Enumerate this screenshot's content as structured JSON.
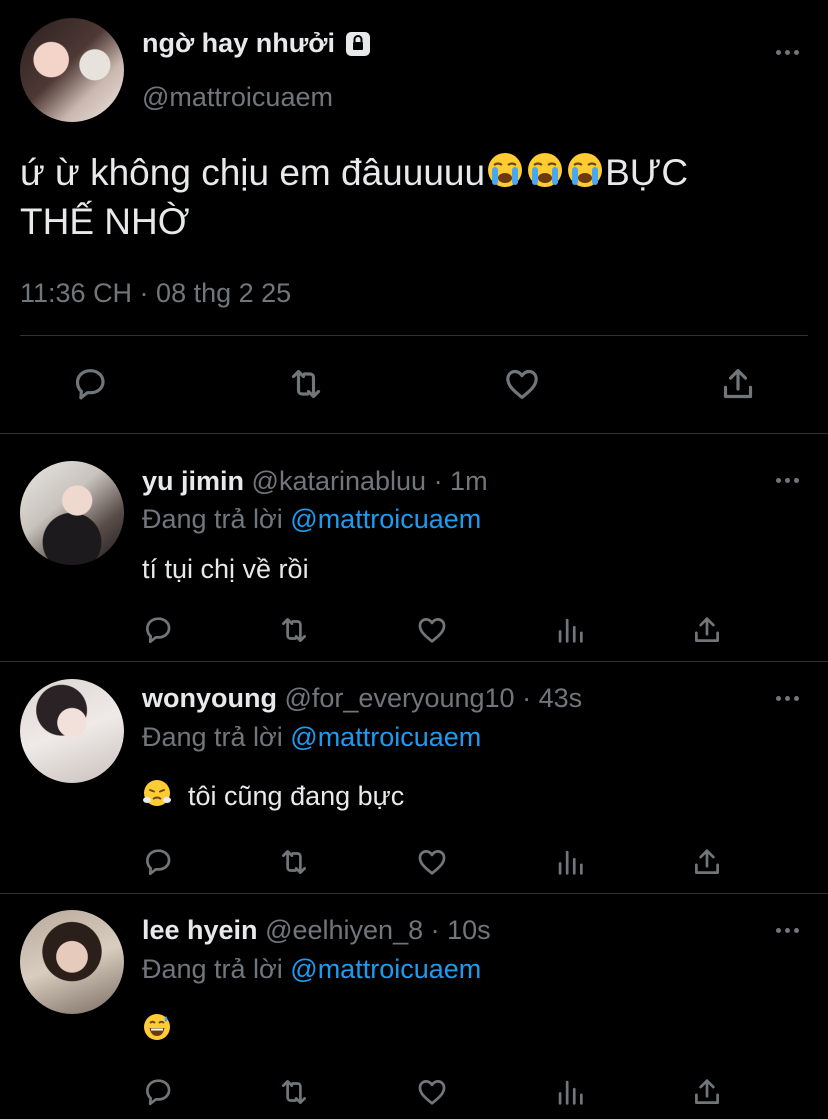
{
  "main_tweet": {
    "display_name": "ngờ hay nhưởi",
    "handle": "@mattroicuaem",
    "text_part1": "ứ ừ không chịu em đâuuuuu",
    "text_part2": "BỰC",
    "text_line2": "THẾ NHỜ",
    "timestamp": "11:36 CH · 08 thg 2 25",
    "icons": [
      "lock-icon",
      "loudly-crying-face-emoji",
      "reply-icon",
      "retweet-icon",
      "like-icon",
      "share-icon",
      "more-icon"
    ]
  },
  "replies": [
    {
      "display_name": "yu jimin",
      "handle": "@katarinabluu",
      "time": "· 1m",
      "replying_label": "Đang trả lời",
      "replying_to": "@mattroicuaem",
      "text": "tí tụi chị về rồi",
      "emoji": ""
    },
    {
      "display_name": "wonyoung",
      "handle": "@for_everyoung10",
      "time": "· 43s",
      "replying_label": "Đang trả lời",
      "replying_to": "@mattroicuaem",
      "text": "tôi cũng đang bực",
      "emoji": "face-with-steam-emoji"
    },
    {
      "display_name": "lee hyein",
      "handle": "@eelhiyen_8",
      "time": "· 10s",
      "replying_label": "Đang trả lời",
      "replying_to": "@mattroicuaem",
      "text": "",
      "emoji": "grinning-sweat-emoji"
    }
  ],
  "colors": {
    "background": "#000000",
    "text": "#e7e9ea",
    "muted": "#71767b",
    "mention": "#1d9bf0",
    "divider": "#2f3336"
  }
}
